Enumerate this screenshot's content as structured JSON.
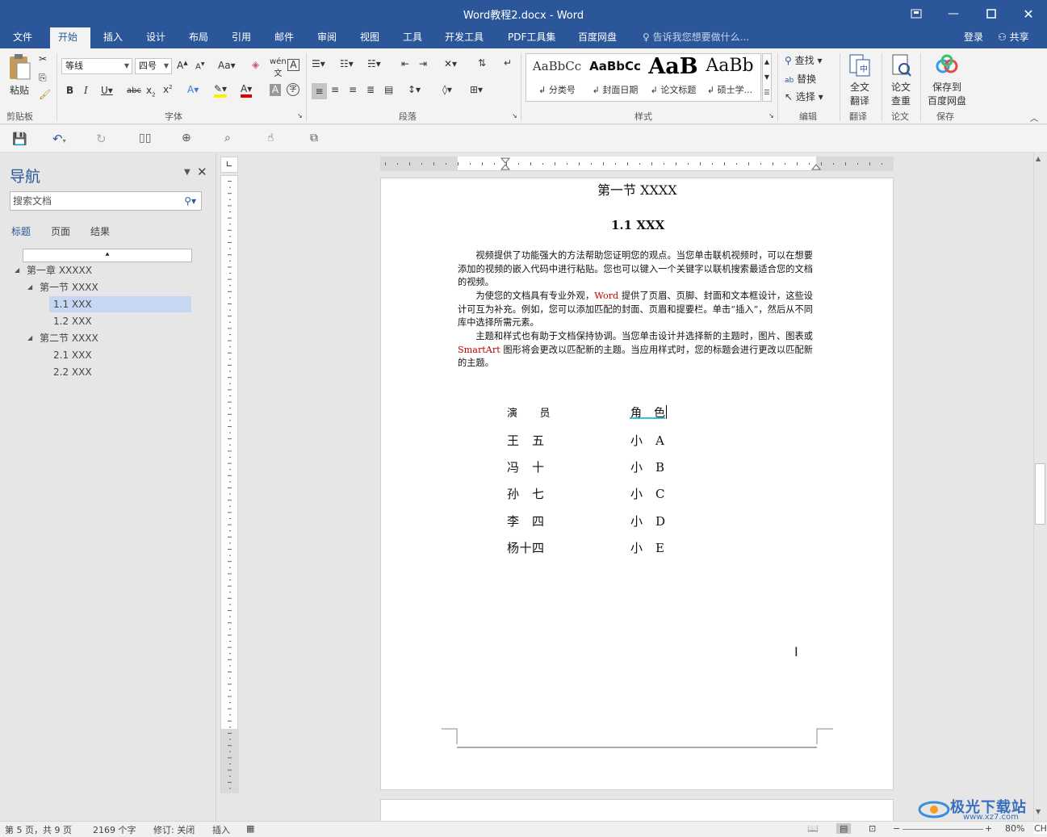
{
  "window": {
    "title": "Word教程2.docx - Word"
  },
  "menu": {
    "tabs": [
      "文件",
      "开始",
      "插入",
      "设计",
      "布局",
      "引用",
      "邮件",
      "审阅",
      "视图",
      "工具",
      "开发工具",
      "PDF工具集",
      "百度网盘"
    ],
    "tell_me": "告诉我您想要做什么...",
    "login": "登录",
    "share": "共享"
  },
  "ribbon": {
    "clipboard": {
      "paste": "粘贴",
      "group": "剪贴板"
    },
    "font": {
      "name": "等线",
      "size": "四号",
      "group": "字体"
    },
    "paragraph": {
      "group": "段落"
    },
    "styles": {
      "group": "样式",
      "items": [
        {
          "preview": "AaBbCc",
          "label": "↲ 分类号"
        },
        {
          "preview": "AaBbCc",
          "label": "↲ 封面日期"
        },
        {
          "preview": "AaB",
          "label": "↲ 论文标题"
        },
        {
          "preview": "AaBb",
          "label": "↲ 硕士学..."
        }
      ]
    },
    "editing": {
      "find": "查找",
      "replace": "替换",
      "select": "选择",
      "group": "编辑"
    },
    "translate": {
      "btn1": "全文",
      "btn2": "翻译",
      "group": "翻译"
    },
    "paper": {
      "btn1": "论文",
      "btn2": "查重",
      "group": "论文"
    },
    "save": {
      "btn1": "保存到",
      "btn2": "百度网盘",
      "group": "保存"
    }
  },
  "nav": {
    "title": "导航",
    "search_placeholder": "搜索文档",
    "tabs": [
      "标题",
      "页面",
      "结果"
    ],
    "tree": [
      {
        "label": "第一章 XXXXX"
      },
      {
        "label": "第一节 XXXX"
      },
      {
        "label": "1.1 XXX"
      },
      {
        "label": "1.2 XXX"
      },
      {
        "label": "第二节 XXXX"
      },
      {
        "label": "2.1 XXX"
      },
      {
        "label": "2.2 XXX"
      }
    ]
  },
  "document": {
    "section_title": "第一节 XXXX",
    "heading": "1.1 XXX",
    "para1": "视频提供了功能强大的方法帮助您证明您的观点。当您单击联机视频时，可以在想要添加的视频的嵌入代码中进行粘贴。您也可以键入一个关键字以联机搜索最适合您的文档的视频。",
    "para2_a": "为使您的文档具有专业外观，",
    "para2_word": "Word",
    "para2_b": " 提供了页眉、页脚、封面和文本框设计，这些设计可互为补充。例如，您可以添加匹配的封面、页眉和提要栏。单击“插入”，然后从不同库中选择所需元素。",
    "para3_a": "主题和样式也有助于文档保持协调。当您单击设计并选择新的主题时，图片、图表或 ",
    "para3_smart": "SmartArt",
    "para3_b": " 图形将会更改以匹配新的主题。当应用样式时，您的标题会进行更改以匹配新的主题。",
    "table": {
      "headers": [
        "演　　员",
        "角　色"
      ],
      "rows": [
        [
          "王　五",
          "小　A"
        ],
        [
          "冯　十",
          "小　B"
        ],
        [
          "孙　七",
          "小　C"
        ],
        [
          "李　四",
          "小　D"
        ],
        [
          "杨十四",
          "小　E"
        ]
      ]
    }
  },
  "status": {
    "page": "第 5 页，共 9 页",
    "words": "2169 个字",
    "track": "修订: 关闭",
    "mode": "插入",
    "zoom": "80%",
    "lang": "CH"
  },
  "watermark": {
    "text": "极光下载站",
    "url": "www.xz7.com"
  },
  "colors": {
    "brand": "#2b579a",
    "red_text": "#c00000"
  }
}
